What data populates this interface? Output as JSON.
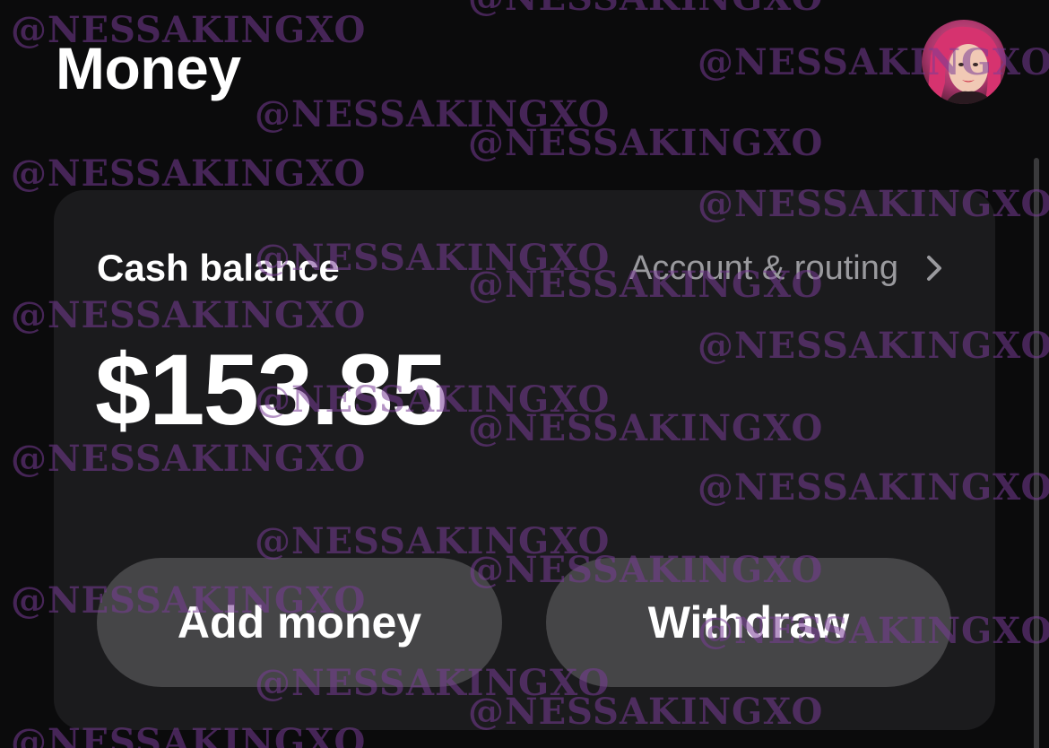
{
  "header": {
    "title": "Money",
    "avatar_icon": "profile-avatar"
  },
  "balance_card": {
    "label": "Cash balance",
    "account_link": "Account & routing",
    "chevron_icon": "chevron-right-icon",
    "amount": "$153.85",
    "buttons": {
      "add_money": "Add money",
      "withdraw": "Withdraw"
    }
  },
  "watermark": {
    "text": "@NESSAKINGXO"
  },
  "colors": {
    "background": "#0b0b0c",
    "card": "#1b1b1d",
    "button": "#454547",
    "muted_text": "#9a9a9e",
    "watermark": "#783c96"
  }
}
